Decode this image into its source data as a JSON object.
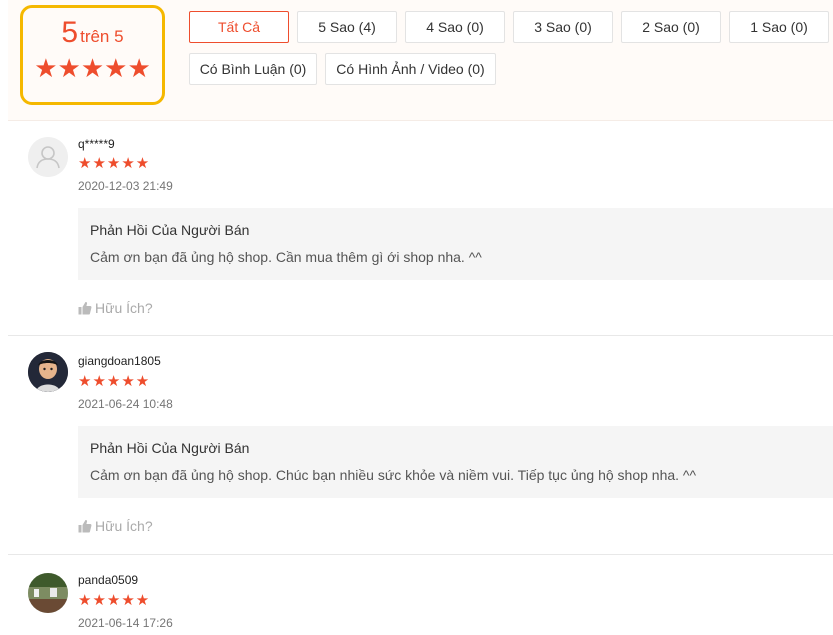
{
  "summary": {
    "score": "5",
    "out_of": "trên 5",
    "stars": "★★★★★"
  },
  "filters": [
    {
      "label": "Tất Cả",
      "active": true
    },
    {
      "label": "5 Sao (4)"
    },
    {
      "label": "4 Sao (0)"
    },
    {
      "label": "3 Sao (0)"
    },
    {
      "label": "2 Sao (0)"
    },
    {
      "label": "1 Sao (0)"
    },
    {
      "label": "Có Bình Luận (0)"
    },
    {
      "label": "Có Hình Ảnh / Video (0)"
    }
  ],
  "colors": {
    "accent": "#ee4d2d",
    "highlight_border": "#f5b800"
  },
  "reviews": [
    {
      "username": "q*****9",
      "rating": 5,
      "stars": "★★★★★",
      "datetime": "2020-12-03 21:49",
      "reply_title": "Phản Hồi Của Người Bán",
      "reply_text": "Cảm ơn bạn đã ủng hộ shop. Cần mua thêm gì ới shop nha. ^^",
      "helpful": "Hữu Ích?"
    },
    {
      "username": "giangdoan1805",
      "rating": 5,
      "stars": "★★★★★",
      "datetime": "2021-06-24 10:48",
      "reply_title": "Phản Hồi Của Người Bán",
      "reply_text": "Cảm ơn bạn đã ủng hộ shop. Chúc bạn nhiều sức khỏe và niềm vui. Tiếp tục ủng hộ shop nha. ^^",
      "helpful": "Hữu Ích?"
    },
    {
      "username": "panda0509",
      "rating": 5,
      "stars": "★★★★★",
      "datetime": "2021-06-14 17:26"
    }
  ]
}
